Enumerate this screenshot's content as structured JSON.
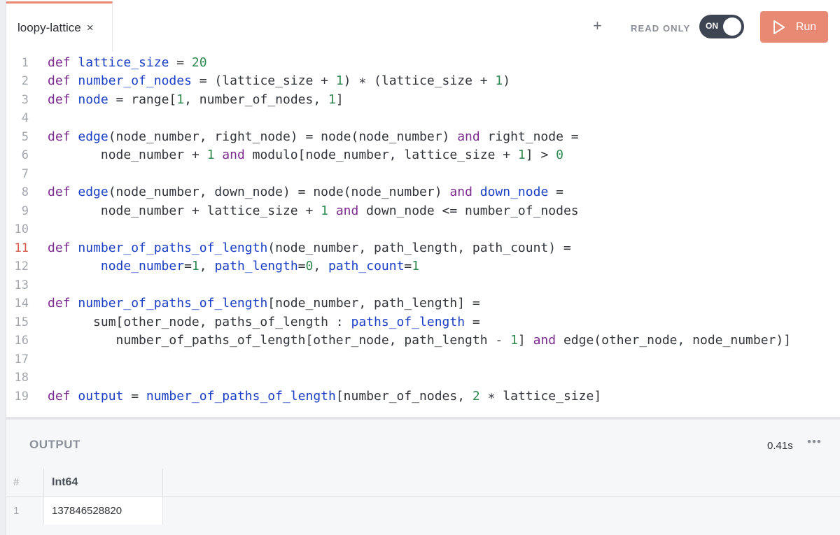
{
  "tab": {
    "label": "loopy-lattice",
    "close": "×"
  },
  "toolbar": {
    "add": "+",
    "read_only_label": "READ ONLY",
    "toggle_state": "ON",
    "run_label": "Run"
  },
  "editor": {
    "active_line": 11,
    "lines": [
      "1",
      "2",
      "3",
      "4",
      "5",
      "6",
      "7",
      "8",
      "9",
      "10",
      "11",
      "12",
      "13",
      "14",
      "15",
      "16",
      "17",
      "18",
      "19"
    ]
  },
  "output": {
    "title": "OUTPUT",
    "time": "0.41s",
    "more": "•••",
    "columns": {
      "index": "#",
      "type": "Int64"
    },
    "rows": [
      {
        "index": "1",
        "value": "137846528820"
      }
    ]
  },
  "colors": {
    "accent": "#e88a73",
    "keyword": "#7b2b8e",
    "identifier": "#1a3fc4",
    "number": "#2e8a4f"
  }
}
